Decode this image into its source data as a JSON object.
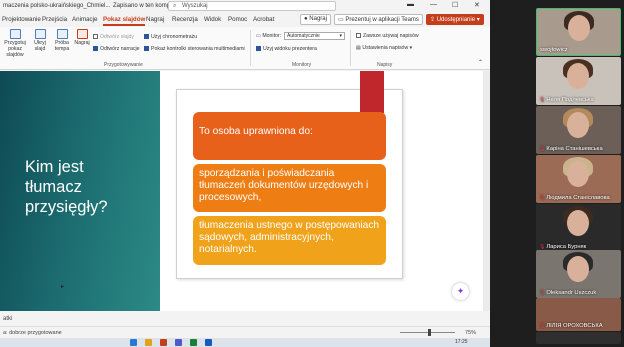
{
  "window": {
    "doc_title": "maczenia polsko-ukraińskiego_Chmiel...",
    "saved_status": "Zapisano w ten komputer",
    "search_placeholder": "Wyszukaj"
  },
  "tabs": [
    "Projektowanie",
    "Przejścia",
    "Animacje",
    "Pokaz slajdów",
    "Nagraj",
    "Recenzja",
    "Widok",
    "Pomoc",
    "Acrobat"
  ],
  "active_tab": "Pokaz slajdów",
  "top_actions": {
    "record": "Nagraj",
    "present_teams": "Prezentuj w aplikacji Teams",
    "share": "Udostępnianie"
  },
  "ribbon": {
    "buttons": [
      {
        "label": "Przygotuj pokaz slajdów"
      },
      {
        "label": "Ukryj slajd"
      },
      {
        "label": "Próba tempa"
      },
      {
        "label": "Nagraj"
      }
    ],
    "checks": [
      {
        "label": "Odtwórz slajdy",
        "checked": false,
        "disabled": true
      },
      {
        "label": "Odtwórz narracje",
        "checked": true,
        "disabled": false
      },
      {
        "label": "Użyj chronometrażu",
        "checked": true,
        "disabled": false
      },
      {
        "label": "Pokaż kontrolki sterowania multimediami",
        "checked": true,
        "disabled": false
      }
    ],
    "group_setup": "Przygotowywanie",
    "monitor_label": "Monitor:",
    "monitor_value": "Automatycznie",
    "presenter_view": "Użyj widoku prezentera",
    "group_monitors": "Monitory",
    "always_subtitles": "Zawsze używaj napisów",
    "subtitle_settings": "Ustawienia napisów",
    "group_captions": "Napisy"
  },
  "slide": {
    "title": "Kim jest tłumacz przysięgły?",
    "box1": "To osoba uprawniona do:",
    "box2": "sporządzania i poświadczania tłumaczeń dokumentów urzędowych i procesowych,",
    "box3": "tłumaczenia ustnego w postępowaniach sądowych, administracyjnych, notarialnych."
  },
  "notes": "atki",
  "status": {
    "accessibility": "a: dobrze przygotowane",
    "zoom": "75%",
    "time": "17:25"
  },
  "participants": [
    {
      "name": "swojtowicz",
      "muted": false,
      "active": true
    },
    {
      "name": "Неля Подлевська",
      "muted": true,
      "active": false
    },
    {
      "name": "Каріна Станішевська",
      "muted": true,
      "active": false
    },
    {
      "name": "Людмила Станіславова",
      "muted": true,
      "active": false
    },
    {
      "name": "Лариса Бурняк",
      "muted": true,
      "active": false
    },
    {
      "name": "Oleksandr Uszczuk",
      "muted": true,
      "active": false
    },
    {
      "name": "ЛІЛІЯ ОРОХОВСЬКА",
      "muted": true,
      "active": false
    }
  ],
  "colors": {
    "accent": "#c43e1c",
    "box1": "#e8611a",
    "box2": "#ee7e14",
    "box3": "#efa21a",
    "teal": "#1b6b6f"
  }
}
